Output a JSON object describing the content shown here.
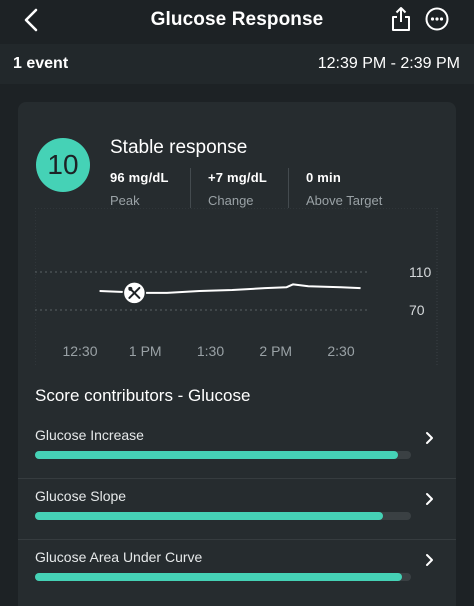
{
  "header": {
    "title": "Glucose Response"
  },
  "event_bar": {
    "count": "1 event",
    "time_range": "12:39 PM - 2:39 PM"
  },
  "score": {
    "value": "10",
    "label": "Stable response",
    "color": "#45d2b6"
  },
  "metrics": [
    {
      "value": "96  mg/dL",
      "label": "Peak"
    },
    {
      "value": "+7  mg/dL",
      "label": "Change"
    },
    {
      "value": "0  min",
      "label": "Above Target"
    }
  ],
  "chart_data": {
    "type": "line",
    "x_ticks": [
      "12:30",
      "1 PM",
      "1:30",
      "2 PM",
      "2:30"
    ],
    "y_ticks": [
      110,
      70
    ],
    "ylim": [
      40,
      140
    ],
    "series": [
      {
        "points": [
          {
            "t": "12:39",
            "y": 90
          },
          {
            "t": "12:50",
            "y": 89
          },
          {
            "t": "12:55",
            "y": 88
          },
          {
            "t": "1:10",
            "y": 88
          },
          {
            "t": "1:25",
            "y": 90
          },
          {
            "t": "1:40",
            "y": 91
          },
          {
            "t": "1:55",
            "y": 93
          },
          {
            "t": "2:05",
            "y": 94
          },
          {
            "t": "2:08",
            "y": 97
          },
          {
            "t": "2:15",
            "y": 95
          },
          {
            "t": "2:30",
            "y": 94
          },
          {
            "t": "2:39",
            "y": 93
          }
        ]
      }
    ],
    "meal_marker": {
      "t": "12:55",
      "y": 88,
      "icon": "fork-knife-icon"
    }
  },
  "contributors": {
    "title": "Score contributors - Glucose",
    "items": [
      {
        "label": "Glucose Increase",
        "score": 0.965
      },
      {
        "label": "Glucose Slope",
        "score": 0.925
      },
      {
        "label": "Glucose Area Under Curve",
        "score": 0.975
      }
    ]
  }
}
